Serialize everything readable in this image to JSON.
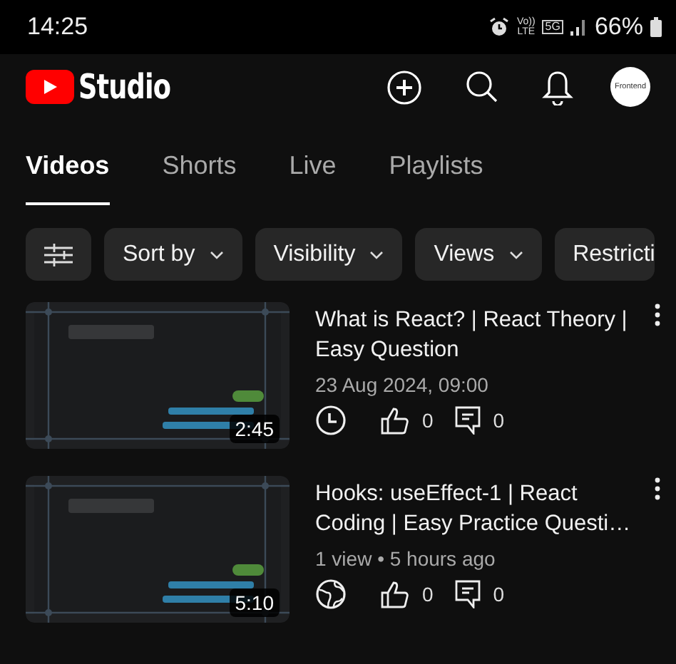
{
  "status_bar": {
    "time": "14:25",
    "volte_label": "Vo))",
    "lte_label": "LTE",
    "network_label": "5G",
    "battery": "66%"
  },
  "app_bar": {
    "title": "Studio",
    "avatar_text": "Frontend"
  },
  "tabs": [
    {
      "label": "Videos",
      "selected": true
    },
    {
      "label": "Shorts",
      "selected": false
    },
    {
      "label": "Live",
      "selected": false
    },
    {
      "label": "Playlists",
      "selected": false
    }
  ],
  "filters": [
    {
      "label": "Sort by",
      "dropdown": true
    },
    {
      "label": "Visibility",
      "dropdown": true
    },
    {
      "label": "Views",
      "dropdown": true
    },
    {
      "label": "Restricti",
      "dropdown": false
    }
  ],
  "videos": [
    {
      "title": "What is React? | React Theory | Easy Question",
      "meta": "23 Aug 2024, 09:00",
      "kind": "scheduled",
      "duration": "2:45",
      "likes": "0",
      "comments": "0"
    },
    {
      "title": "Hooks: useEffect-1 | React Coding | Easy Practice Questi…",
      "meta": "1 view • 5 hours ago",
      "kind": "public",
      "duration": "5:10",
      "likes": "0",
      "comments": "0"
    }
  ]
}
